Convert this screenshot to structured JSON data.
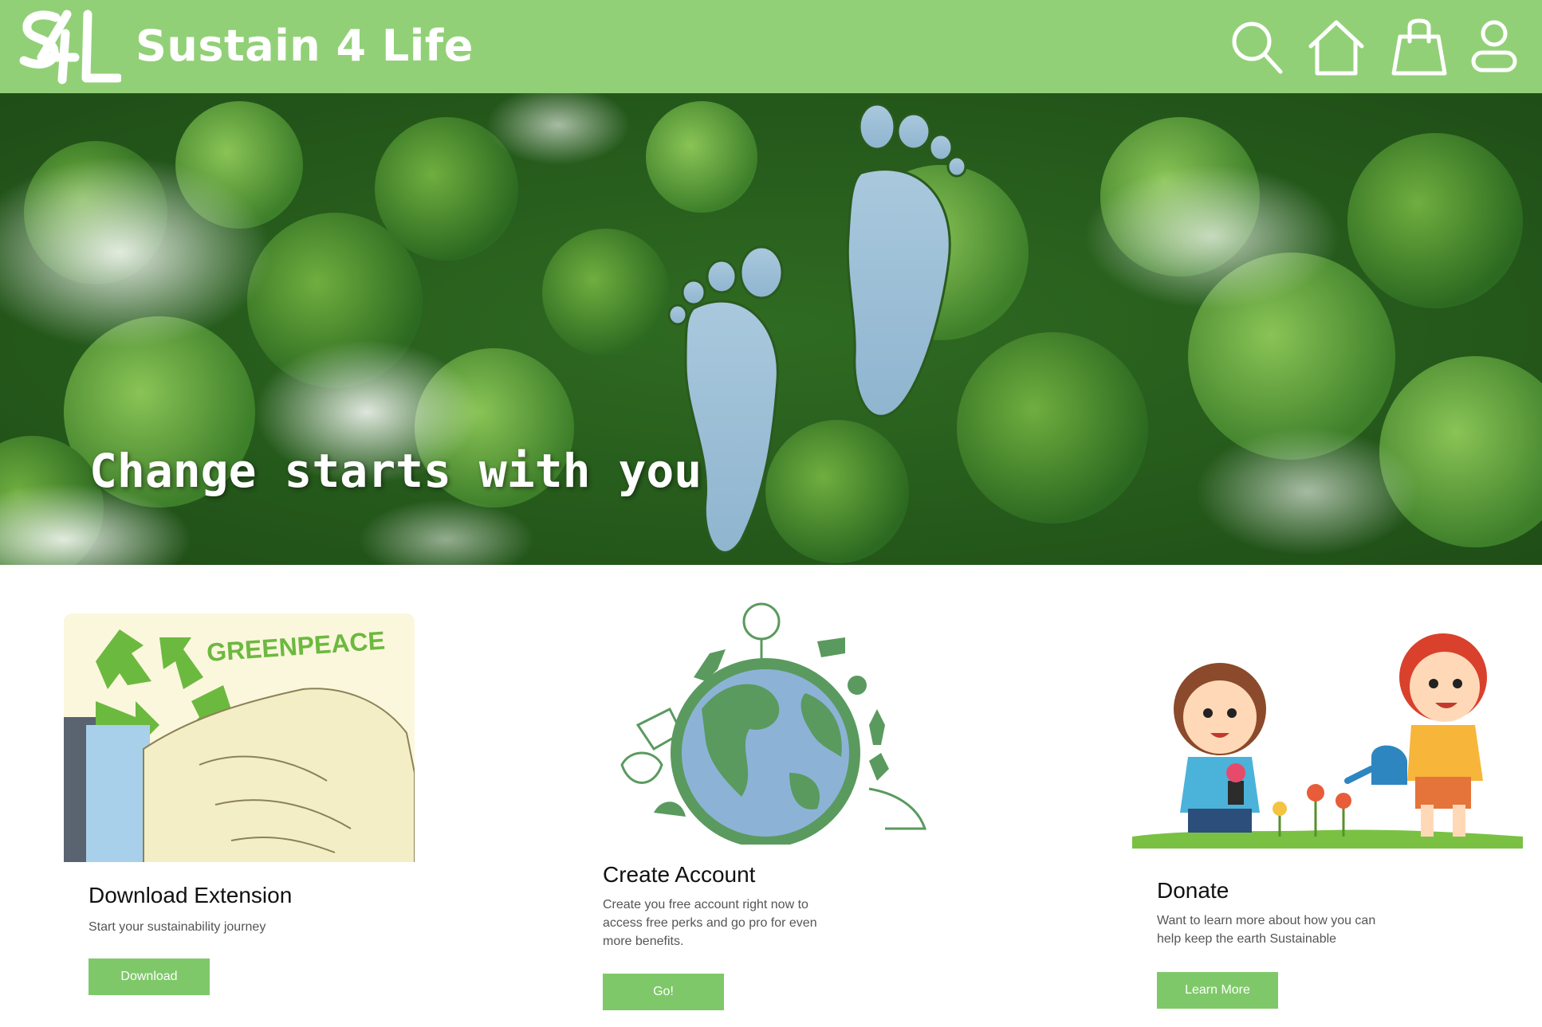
{
  "header": {
    "logo_text": "S4L",
    "brand": "Sustain 4 Life",
    "icons": [
      "search-icon",
      "home-icon",
      "shopping-bag-icon",
      "user-icon"
    ],
    "background": "#92d077"
  },
  "hero": {
    "headline": "Change starts with you"
  },
  "cards": [
    {
      "title": "Download Extension",
      "description": "Start your sustainability journey",
      "button": "Download",
      "image_label": "GREENPEACE"
    },
    {
      "title": "Create Account",
      "description": "Create you free account right now to access free perks and go pro for even more benefits.",
      "button": "Go!"
    },
    {
      "title": "Donate",
      "description": "Want to learn more about how you can help keep the earth Sustainable",
      "button": "Learn More"
    }
  ],
  "colors": {
    "accent": "#92d077",
    "button": "#7fc86a"
  }
}
